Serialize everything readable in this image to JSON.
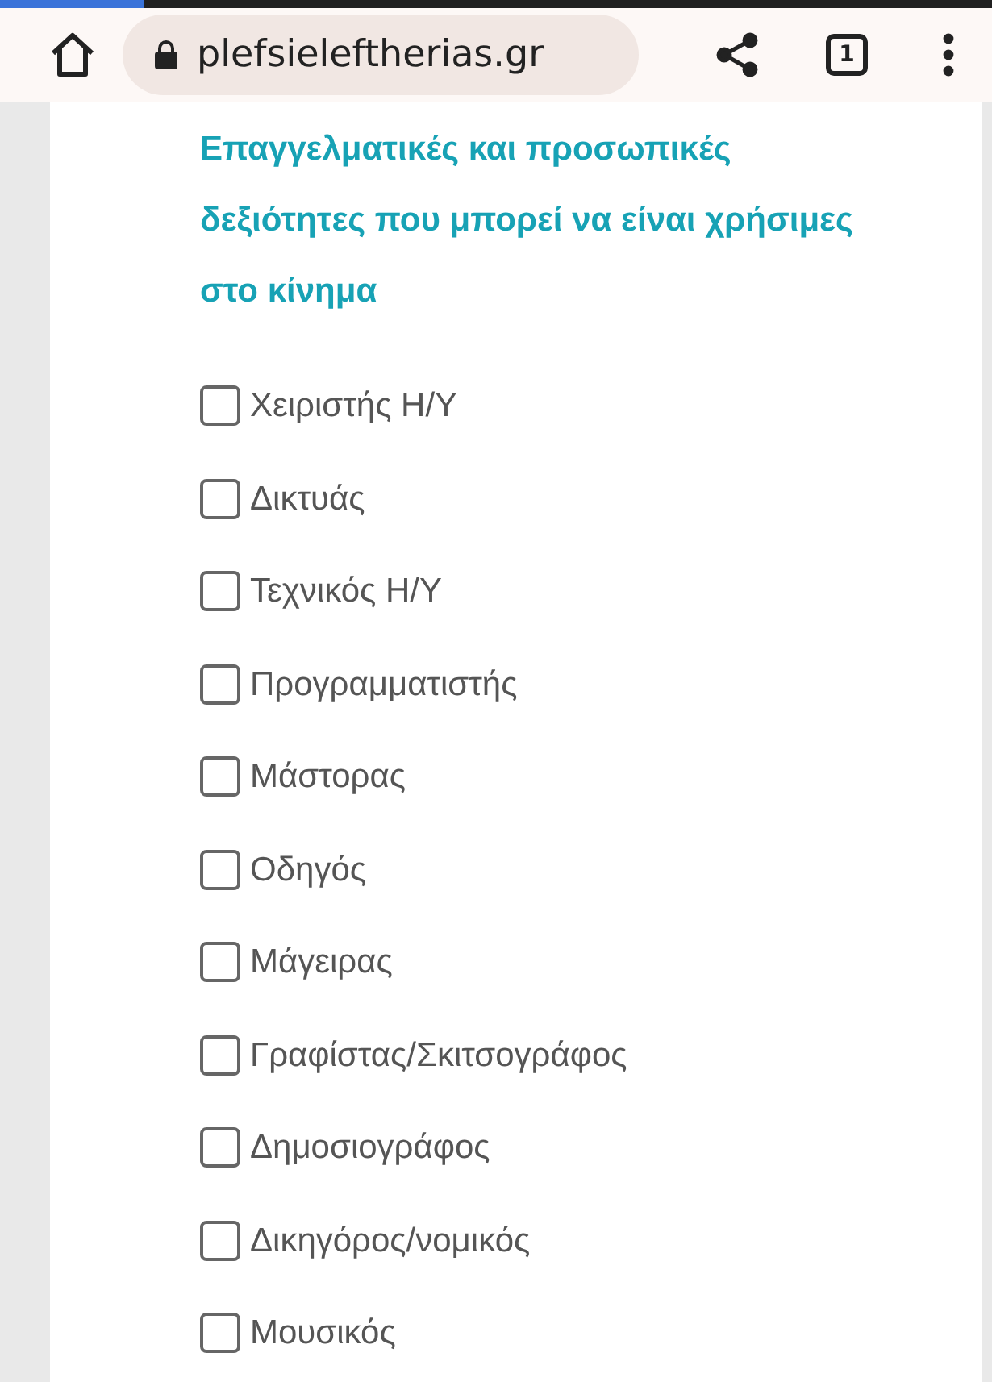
{
  "browser": {
    "url": "plefsieleftherias.gr",
    "tab_count": "1",
    "loading": {
      "level": 0.145
    }
  },
  "section": {
    "title": "Επαγγελματικές και προσωπικές δεξιότητες που μπορεί να είναι χρήσιμες στο κίνημα",
    "options": [
      {
        "label": "Χειριστής Η/Υ",
        "checked": false
      },
      {
        "label": "Δικτυάς",
        "checked": false
      },
      {
        "label": "Τεχνικός Η/Υ",
        "checked": false
      },
      {
        "label": "Προγραμματιστής",
        "checked": false
      },
      {
        "label": "Μάστορας",
        "checked": false
      },
      {
        "label": "Οδηγός",
        "checked": false
      },
      {
        "label": "Μάγειρας",
        "checked": false
      },
      {
        "label": "Γραφίστας/Σκιτσογράφος",
        "checked": false
      },
      {
        "label": "Δημοσιογράφος",
        "checked": false
      },
      {
        "label": "Δικηγόρος/νομικός",
        "checked": false
      },
      {
        "label": "Μουσικός",
        "checked": false
      }
    ]
  }
}
